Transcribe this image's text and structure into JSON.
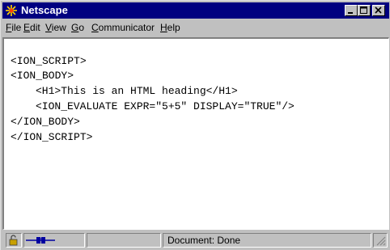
{
  "window": {
    "title": "Netscape"
  },
  "menu": {
    "items": [
      "File",
      "Edit",
      "View",
      "Go",
      "Communicator",
      "Help"
    ]
  },
  "content": {
    "lines": [
      "<ION_SCRIPT>",
      "<ION_BODY>",
      "<H1>This is an HTML heading</H1>",
      "<ION_EVALUATE EXPR=\"5+5\" DISPLAY=\"TRUE\"/>",
      "</ION_BODY>",
      "</ION_SCRIPT>"
    ]
  },
  "status": {
    "text": "Document: Done"
  },
  "colors": {
    "titlebar": "#000080",
    "face": "#c0c0c0",
    "content_bg": "#ffffff"
  }
}
